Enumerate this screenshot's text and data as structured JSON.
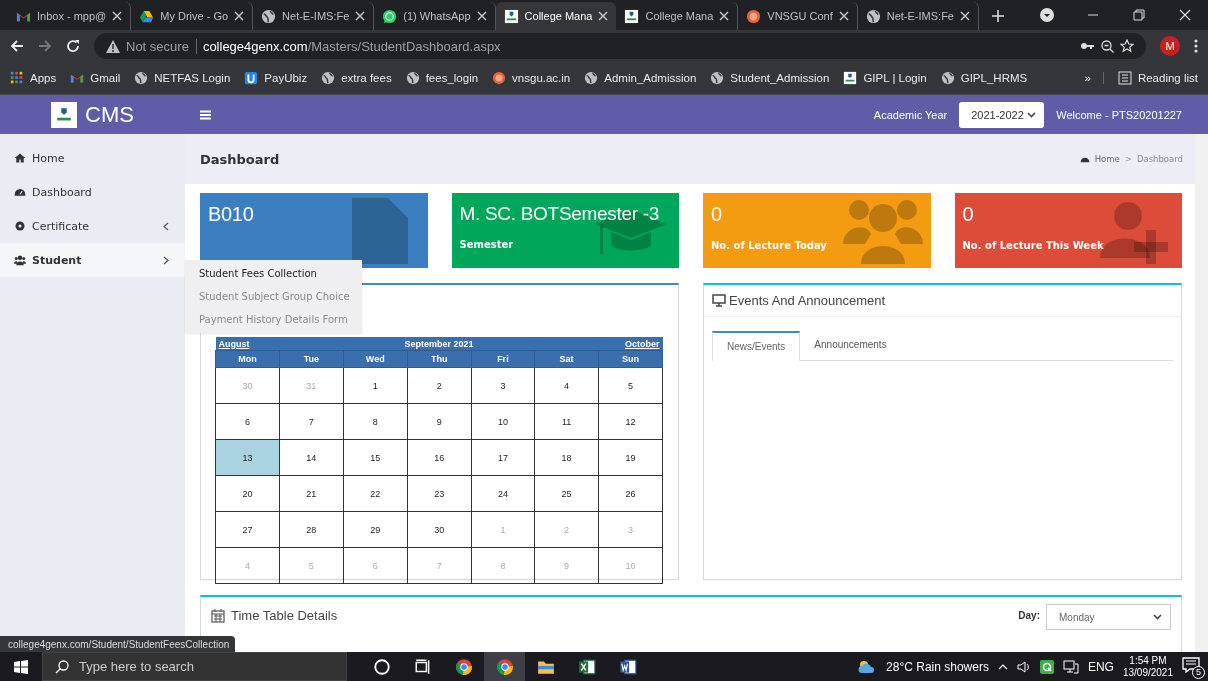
{
  "browser": {
    "tabs": [
      {
        "title": "Inbox - mpp@",
        "kind": "gmail",
        "selected": false
      },
      {
        "title": "My Drive - Go",
        "kind": "drive",
        "selected": false
      },
      {
        "title": "Net-E-IMS:Fe",
        "kind": "globe",
        "selected": false
      },
      {
        "title": "(1) WhatsApp",
        "kind": "whatsapp",
        "selected": false
      },
      {
        "title": "College Mana",
        "kind": "college",
        "selected": true
      },
      {
        "title": "College Mana",
        "kind": "college",
        "selected": false
      },
      {
        "title": "VNSGU Conf",
        "kind": "vnsgu",
        "selected": false
      },
      {
        "title": "Net-E-IMS:Fe",
        "kind": "globe",
        "selected": false
      }
    ],
    "security": "Not secure",
    "url_host": "college4genx.com",
    "url_path": "/Masters/StudentDashboard.aspx",
    "avatar": "M",
    "bookmarks": [
      {
        "label": "Apps",
        "kind": "apps"
      },
      {
        "label": "Gmail",
        "kind": "gmail"
      },
      {
        "label": "NETFAS Login",
        "kind": "globe"
      },
      {
        "label": "PayUbiz",
        "kind": "payubiz"
      },
      {
        "label": "extra fees",
        "kind": "globe"
      },
      {
        "label": "fees_login",
        "kind": "globe"
      },
      {
        "label": "vnsgu.ac.in",
        "kind": "vnsgu"
      },
      {
        "label": "Admin_Admission",
        "kind": "globe"
      },
      {
        "label": "Student_Admission",
        "kind": "globe"
      },
      {
        "label": "GIPL | Login",
        "kind": "college"
      },
      {
        "label": "GIPL_HRMS",
        "kind": "globe"
      }
    ],
    "more": "»",
    "reading_list": "Reading list"
  },
  "app": {
    "brand": "CMS",
    "academic_year_label": "Academic Year",
    "academic_year": "2021-2022",
    "welcome": "Welcome - PTS20201227"
  },
  "sidebar": {
    "items": [
      {
        "label": "Home",
        "kind": "home",
        "selected": false
      },
      {
        "label": "Dashboard",
        "kind": "dashboard",
        "selected": false
      },
      {
        "label": "Certificate",
        "kind": "gear",
        "expanded": false,
        "selected": false
      },
      {
        "label": "Student",
        "kind": "users",
        "expanded": true,
        "selected": true,
        "children": [
          {
            "label": "Student Fees Collection",
            "selected": true
          },
          {
            "label": "Student Subject Group Choice",
            "selected": false
          },
          {
            "label": "Payment History Details Form",
            "selected": false
          }
        ]
      }
    ]
  },
  "page": {
    "title": "Dashboard",
    "breadcrumb": [
      "Home",
      "Dashboard"
    ],
    "separator": ">"
  },
  "cards": [
    {
      "value": "B010",
      "kind": "file",
      "color": "#3c7fc0"
    },
    {
      "value": "M. SC. BOTSemester -3",
      "label": "Semester",
      "kind": "cap",
      "color": "#00a65a"
    },
    {
      "value": "0",
      "label": "No. of Lecture Today",
      "kind": "users",
      "color": "#f39c12"
    },
    {
      "value": "0",
      "label": "No. of Lecture This Week",
      "kind": "user-plus",
      "color": "#dd4b39"
    }
  ],
  "calendar": {
    "prev": "August",
    "month": "September 2021",
    "next": "October",
    "day_names": [
      "Mon",
      "Tue",
      "Wed",
      "Thu",
      "Fri",
      "Sat",
      "Sun"
    ],
    "weeks": [
      {
        "days": [
          {
            "d": "30",
            "muted": true,
            "selected": false
          },
          {
            "d": "31",
            "muted": true,
            "selected": false
          },
          {
            "d": "1",
            "muted": false,
            "selected": false
          },
          {
            "d": "2",
            "muted": false,
            "selected": false
          },
          {
            "d": "3",
            "muted": false,
            "selected": false
          },
          {
            "d": "4",
            "muted": false,
            "selected": false
          },
          {
            "d": "5",
            "muted": false,
            "selected": false
          }
        ]
      },
      {
        "days": [
          {
            "d": "6",
            "muted": false,
            "selected": false
          },
          {
            "d": "7",
            "muted": false,
            "selected": false
          },
          {
            "d": "8",
            "muted": false,
            "selected": false
          },
          {
            "d": "9",
            "muted": false,
            "selected": false
          },
          {
            "d": "10",
            "muted": false,
            "selected": false
          },
          {
            "d": "11",
            "muted": false,
            "selected": false
          },
          {
            "d": "12",
            "muted": false,
            "selected": false
          }
        ]
      },
      {
        "days": [
          {
            "d": "13",
            "muted": false,
            "selected": true
          },
          {
            "d": "14",
            "muted": false,
            "selected": false
          },
          {
            "d": "15",
            "muted": false,
            "selected": false
          },
          {
            "d": "16",
            "muted": false,
            "selected": false
          },
          {
            "d": "17",
            "muted": false,
            "selected": false
          },
          {
            "d": "18",
            "muted": false,
            "selected": false
          },
          {
            "d": "19",
            "muted": false,
            "selected": false
          }
        ]
      },
      {
        "days": [
          {
            "d": "20",
            "muted": false,
            "selected": false
          },
          {
            "d": "21",
            "muted": false,
            "selected": false
          },
          {
            "d": "22",
            "muted": false,
            "selected": false
          },
          {
            "d": "23",
            "muted": false,
            "selected": false
          },
          {
            "d": "24",
            "muted": false,
            "selected": false
          },
          {
            "d": "25",
            "muted": false,
            "selected": false
          },
          {
            "d": "26",
            "muted": false,
            "selected": false
          }
        ]
      },
      {
        "days": [
          {
            "d": "27",
            "muted": false,
            "selected": false
          },
          {
            "d": "28",
            "muted": false,
            "selected": false
          },
          {
            "d": "29",
            "muted": false,
            "selected": false
          },
          {
            "d": "30",
            "muted": false,
            "selected": false
          },
          {
            "d": "1",
            "muted": true,
            "selected": false
          },
          {
            "d": "2",
            "muted": true,
            "selected": false
          },
          {
            "d": "3",
            "muted": true,
            "selected": false
          }
        ]
      },
      {
        "days": [
          {
            "d": "4",
            "muted": true,
            "selected": false
          },
          {
            "d": "5",
            "muted": true,
            "selected": false
          },
          {
            "d": "6",
            "muted": true,
            "selected": false
          },
          {
            "d": "7",
            "muted": true,
            "selected": false
          },
          {
            "d": "8",
            "muted": true,
            "selected": false
          },
          {
            "d": "9",
            "muted": true,
            "selected": false
          },
          {
            "d": "10",
            "muted": true,
            "selected": false
          }
        ]
      }
    ]
  },
  "events": {
    "title": "Events And Announcement",
    "tabs": [
      {
        "label": "News/Events",
        "selected": true
      },
      {
        "label": "Announcements",
        "selected": false
      }
    ]
  },
  "timetable": {
    "title": "Time Table Details",
    "day_label": "Day:",
    "day": "Monday"
  },
  "status_url": "college4genx.com/Student/StudentFeesCollection",
  "taskbar": {
    "search_placeholder": "Type here to search",
    "apps": [
      {
        "kind": "cortana",
        "selected": false
      },
      {
        "kind": "taskview",
        "selected": false
      },
      {
        "kind": "chrome",
        "selected": false
      },
      {
        "kind": "chrome",
        "selected": true
      },
      {
        "kind": "explorer",
        "selected": false
      },
      {
        "kind": "excel",
        "selected": false
      },
      {
        "kind": "word",
        "selected": false
      }
    ],
    "weather": "28°C  Rain showers",
    "language": "ENG",
    "time": "1:54 PM",
    "date": "13/09/2021",
    "notification_count": "5"
  }
}
